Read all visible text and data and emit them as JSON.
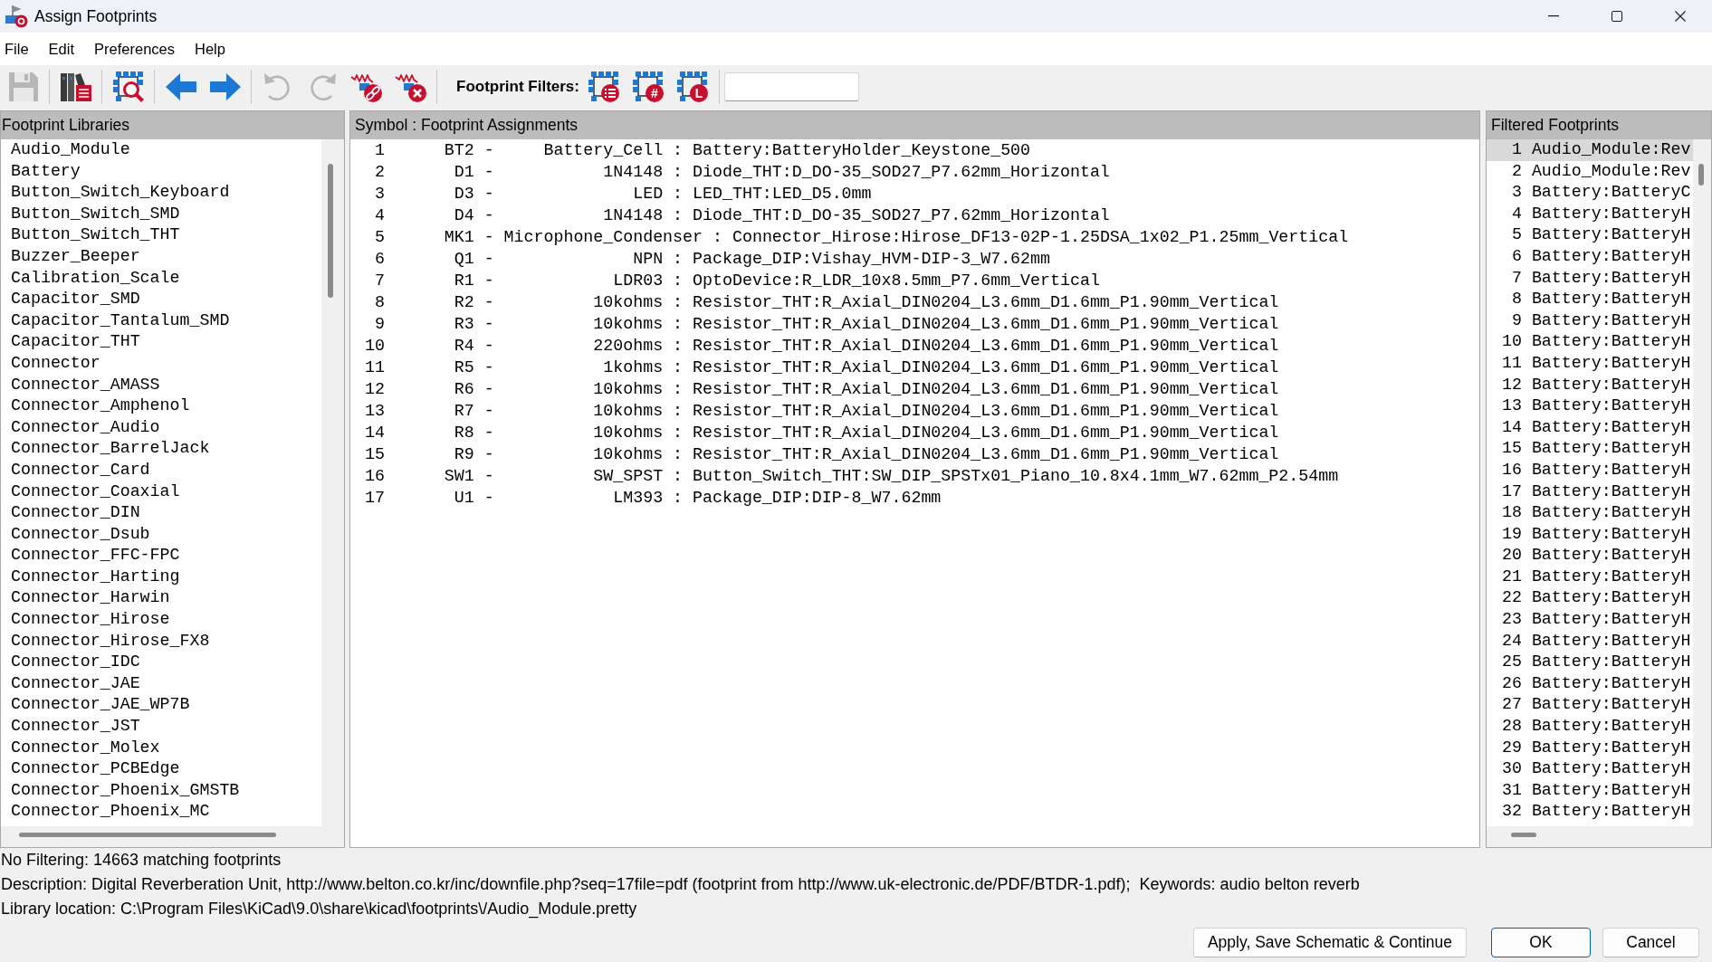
{
  "window": {
    "title": "Assign Footprints"
  },
  "menu": [
    "File",
    "Edit",
    "Preferences",
    "Help"
  ],
  "toolbar": {
    "groups": [
      [
        {
          "kind": "save",
          "disabled": true
        }
      ],
      [
        {
          "kind": "libraries",
          "disabled": false
        }
      ],
      [
        {
          "kind": "footprint_viewer",
          "disabled": false
        }
      ],
      [
        {
          "kind": "previous",
          "disabled": false
        },
        {
          "kind": "next",
          "disabled": false
        }
      ],
      [
        {
          "kind": "undo",
          "disabled": true
        },
        {
          "kind": "redo",
          "disabled": true
        },
        {
          "kind": "associate",
          "disabled": false
        },
        {
          "kind": "delete_associations",
          "disabled": false
        }
      ]
    ],
    "filter_label": "Footprint Filters:",
    "filters": [
      {
        "kind": "keywords",
        "on": false
      },
      {
        "kind": "pin_count",
        "badge": "#",
        "on": false
      },
      {
        "kind": "library",
        "badge": "L",
        "on": false
      }
    ]
  },
  "libraries": {
    "title": "Footprint Libraries",
    "items": [
      "Audio_Module",
      "Battery",
      "Button_Switch_Keyboard",
      "Button_Switch_SMD",
      "Button_Switch_THT",
      "Buzzer_Beeper",
      "Calibration_Scale",
      "Capacitor_SMD",
      "Capacitor_Tantalum_SMD",
      "Capacitor_THT",
      "Connector",
      "Connector_AMASS",
      "Connector_Amphenol",
      "Connector_Audio",
      "Connector_BarrelJack",
      "Connector_Card",
      "Connector_Coaxial",
      "Connector_DIN",
      "Connector_Dsub",
      "Connector_FFC-FPC",
      "Connector_Harting",
      "Connector_Harwin",
      "Connector_Hirose",
      "Connector_Hirose_FX8",
      "Connector_IDC",
      "Connector_JAE",
      "Connector_JAE_WP7B",
      "Connector_JST",
      "Connector_Molex",
      "Connector_PCBEdge",
      "Connector_Phoenix_GMSTB",
      "Connector_Phoenix_MC"
    ]
  },
  "assignments": {
    "title": "Symbol : Footprint Assignments",
    "rows": [
      {
        "number": "1",
        "reference": "BT2",
        "dash": "-",
        "value": "Battery_Cell",
        "colon": ":",
        "footprint": "Battery:BatteryHolder_Keystone_500"
      },
      {
        "number": "2",
        "reference": "D1",
        "dash": "-",
        "value": "1N4148",
        "colon": ":",
        "footprint": "Diode_THT:D_DO-35_SOD27_P7.62mm_Horizontal"
      },
      {
        "number": "3",
        "reference": "D3",
        "dash": "-",
        "value": "LED",
        "colon": ":",
        "footprint": "LED_THT:LED_D5.0mm"
      },
      {
        "number": "4",
        "reference": "D4",
        "dash": "-",
        "value": "1N4148",
        "colon": ":",
        "footprint": "Diode_THT:D_DO-35_SOD27_P7.62mm_Horizontal"
      },
      {
        "number": "5",
        "reference": "MK1",
        "dash": "-",
        "value": "Microphone_Condenser",
        "colon": ":",
        "footprint": "Connector_Hirose:Hirose_DF13-02P-1.25DSA_1x02_P1.25mm_Vertical"
      },
      {
        "number": "6",
        "reference": "Q1",
        "dash": "-",
        "value": "NPN",
        "colon": ":",
        "footprint": "Package_DIP:Vishay_HVM-DIP-3_W7.62mm"
      },
      {
        "number": "7",
        "reference": "R1",
        "dash": "-",
        "value": "LDR03",
        "colon": ":",
        "footprint": "OptoDevice:R_LDR_10x8.5mm_P7.6mm_Vertical"
      },
      {
        "number": "8",
        "reference": "R2",
        "dash": "-",
        "value": "10kohms",
        "colon": ":",
        "footprint": "Resistor_THT:R_Axial_DIN0204_L3.6mm_D1.6mm_P1.90mm_Vertical"
      },
      {
        "number": "9",
        "reference": "R3",
        "dash": "-",
        "value": "10kohms",
        "colon": ":",
        "footprint": "Resistor_THT:R_Axial_DIN0204_L3.6mm_D1.6mm_P1.90mm_Vertical"
      },
      {
        "number": "10",
        "reference": "R4",
        "dash": "-",
        "value": "220ohms",
        "colon": ":",
        "footprint": "Resistor_THT:R_Axial_DIN0204_L3.6mm_D1.6mm_P1.90mm_Vertical"
      },
      {
        "number": "11",
        "reference": "R5",
        "dash": "-",
        "value": "1kohms",
        "colon": ":",
        "footprint": "Resistor_THT:R_Axial_DIN0204_L3.6mm_D1.6mm_P1.90mm_Vertical"
      },
      {
        "number": "12",
        "reference": "R6",
        "dash": "-",
        "value": "10kohms",
        "colon": ":",
        "footprint": "Resistor_THT:R_Axial_DIN0204_L3.6mm_D1.6mm_P1.90mm_Vertical"
      },
      {
        "number": "13",
        "reference": "R7",
        "dash": "-",
        "value": "10kohms",
        "colon": ":",
        "footprint": "Resistor_THT:R_Axial_DIN0204_L3.6mm_D1.6mm_P1.90mm_Vertical"
      },
      {
        "number": "14",
        "reference": "R8",
        "dash": "-",
        "value": "10kohms",
        "colon": ":",
        "footprint": "Resistor_THT:R_Axial_DIN0204_L3.6mm_D1.6mm_P1.90mm_Vertical"
      },
      {
        "number": "15",
        "reference": "R9",
        "dash": "-",
        "value": "10kohms",
        "colon": ":",
        "footprint": "Resistor_THT:R_Axial_DIN0204_L3.6mm_D1.6mm_P1.90mm_Vertical"
      },
      {
        "number": "16",
        "reference": "SW1",
        "dash": "-",
        "value": "SW_SPST",
        "colon": ":",
        "footprint": "Button_Switch_THT:SW_DIP_SPSTx01_Piano_10.8x4.1mm_W7.62mm_P2.54mm"
      },
      {
        "number": "17",
        "reference": "U1",
        "dash": "-",
        "value": "LM393",
        "colon": ":",
        "footprint": "Package_DIP:DIP-8_W7.62mm"
      }
    ]
  },
  "filtered_footprints": {
    "title": "Filtered Footprints",
    "items": [
      {
        "number": "1",
        "name": "Audio_Module:Rev",
        "selected": true
      },
      {
        "number": "2",
        "name": "Audio_Module:Rev",
        "selected": false
      },
      {
        "number": "3",
        "name": "Battery:BatteryC",
        "selected": false
      },
      {
        "number": "4",
        "name": "Battery:BatteryH",
        "selected": false
      },
      {
        "number": "5",
        "name": "Battery:BatteryH",
        "selected": false
      },
      {
        "number": "6",
        "name": "Battery:BatteryH",
        "selected": false
      },
      {
        "number": "7",
        "name": "Battery:BatteryH",
        "selected": false
      },
      {
        "number": "8",
        "name": "Battery:BatteryH",
        "selected": false
      },
      {
        "number": "9",
        "name": "Battery:BatteryH",
        "selected": false
      },
      {
        "number": "10",
        "name": "Battery:BatteryH",
        "selected": false
      },
      {
        "number": "11",
        "name": "Battery:BatteryH",
        "selected": false
      },
      {
        "number": "12",
        "name": "Battery:BatteryH",
        "selected": false
      },
      {
        "number": "13",
        "name": "Battery:BatteryH",
        "selected": false
      },
      {
        "number": "14",
        "name": "Battery:BatteryH",
        "selected": false
      },
      {
        "number": "15",
        "name": "Battery:BatteryH",
        "selected": false
      },
      {
        "number": "16",
        "name": "Battery:BatteryH",
        "selected": false
      },
      {
        "number": "17",
        "name": "Battery:BatteryH",
        "selected": false
      },
      {
        "number": "18",
        "name": "Battery:BatteryH",
        "selected": false
      },
      {
        "number": "19",
        "name": "Battery:BatteryH",
        "selected": false
      },
      {
        "number": "20",
        "name": "Battery:BatteryH",
        "selected": false
      },
      {
        "number": "21",
        "name": "Battery:BatteryH",
        "selected": false
      },
      {
        "number": "22",
        "name": "Battery:BatteryH",
        "selected": false
      },
      {
        "number": "23",
        "name": "Battery:BatteryH",
        "selected": false
      },
      {
        "number": "24",
        "name": "Battery:BatteryH",
        "selected": false
      },
      {
        "number": "25",
        "name": "Battery:BatteryH",
        "selected": false
      },
      {
        "number": "26",
        "name": "Battery:BatteryH",
        "selected": false
      },
      {
        "number": "27",
        "name": "Battery:BatteryH",
        "selected": false
      },
      {
        "number": "28",
        "name": "Battery:BatteryH",
        "selected": false
      },
      {
        "number": "29",
        "name": "Battery:BatteryH",
        "selected": false
      },
      {
        "number": "30",
        "name": "Battery:BatteryH",
        "selected": false
      },
      {
        "number": "31",
        "name": "Battery:BatteryH",
        "selected": false
      },
      {
        "number": "32",
        "name": "Battery:BatteryH",
        "selected": false
      }
    ]
  },
  "status": {
    "filter_status": "No Filtering: 14663 matching footprints",
    "description": "Description: Digital Reverberation Unit, http://www.belton.co.kr/inc/downfile.php?seq=17file=pdf (footprint from http://www.uk-electronic.de/PDF/BTDR-1.pdf);  Keywords: audio belton reverb",
    "library_location": "Library location: C:\\Program Files\\KiCad\\9.0\\share\\kicad\\footprints\\/Audio_Module.pretty"
  },
  "buttons": [
    {
      "label": "Apply, Save Schematic & Continue",
      "default": false
    },
    {
      "label": "OK",
      "default": true
    },
    {
      "label": "Cancel",
      "default": false
    }
  ]
}
